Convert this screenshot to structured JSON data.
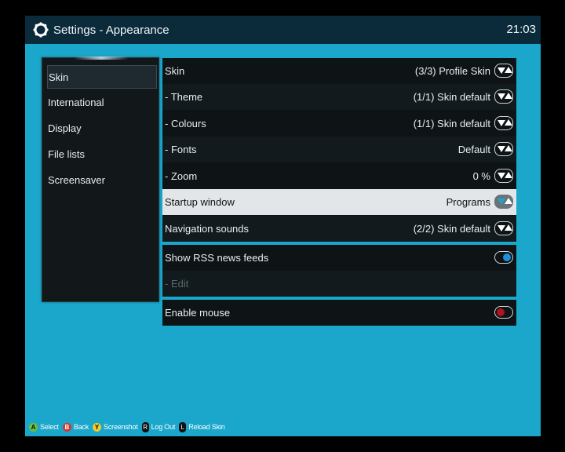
{
  "header": {
    "title": "Settings - Appearance",
    "time": "21:03",
    "logo_icon": "kodi-gear-icon"
  },
  "sidebar": {
    "items": [
      {
        "label": "Skin",
        "active": true
      },
      {
        "label": "International"
      },
      {
        "label": "Display"
      },
      {
        "label": "File lists"
      },
      {
        "label": "Screensaver"
      }
    ]
  },
  "settings": {
    "skin_group": [
      {
        "label": "Skin",
        "value": "(3/3) Profile Skin",
        "control": "spinner"
      },
      {
        "label": "- Theme",
        "value": "(1/1) Skin default",
        "control": "spinner"
      },
      {
        "label": "- Colours",
        "value": "(1/1) Skin default",
        "control": "spinner"
      },
      {
        "label": "- Fonts",
        "value": "Default",
        "control": "spinner"
      },
      {
        "label": "- Zoom",
        "value": "0 %",
        "control": "spinner"
      },
      {
        "label": "Startup window",
        "value": "Programs",
        "control": "spinner",
        "focused": true
      },
      {
        "label": "Navigation sounds",
        "value": "(2/2) Skin default",
        "control": "spinner"
      }
    ],
    "rss_group": [
      {
        "label": "Show RSS news feeds",
        "control": "toggle",
        "state": "on"
      },
      {
        "label": "- Edit",
        "disabled": true
      }
    ],
    "mouse_group": [
      {
        "label": "Enable mouse",
        "control": "toggle",
        "state": "off"
      }
    ]
  },
  "footer": {
    "items": [
      {
        "key": "A",
        "label": "Select"
      },
      {
        "key": "B",
        "label": "Back"
      },
      {
        "key": "Y",
        "label": "Screenshot"
      },
      {
        "key": "R",
        "label": "Log Out"
      },
      {
        "key": "L",
        "label": "Reload Skin"
      }
    ]
  },
  "colors": {
    "background": "#1aa7cb",
    "topbar": "#0b2b3a",
    "panel": "#0e1316",
    "focus_row": "#e3e6e8",
    "toggle_on": "#1c8fe0",
    "toggle_off": "#b3141b"
  }
}
